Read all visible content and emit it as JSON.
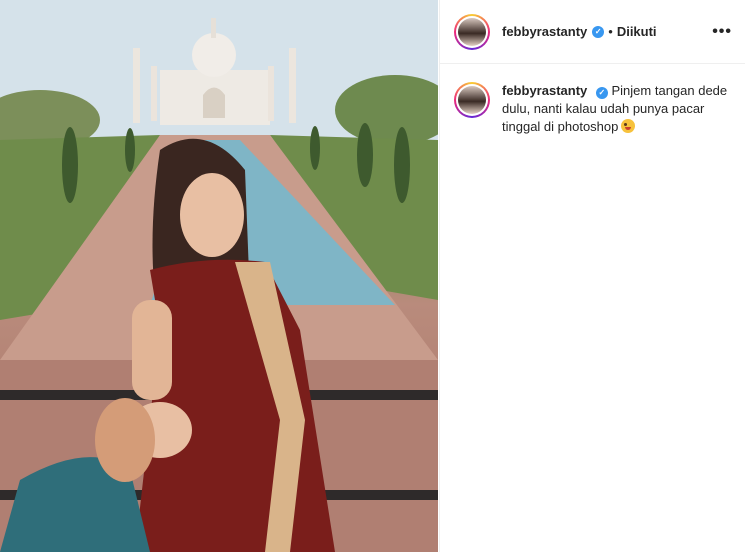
{
  "post": {
    "username": "febbyrastanty",
    "verified": true,
    "separator": "•",
    "follow_status": "Diikuti",
    "more_icon": "more-options-icon",
    "caption_text": "Pinjem tangan dede dulu, nanti kalau udah punya pacar tinggal di photoshop",
    "caption_emoji": "winking-face-with-tongue-emoji"
  },
  "colors": {
    "verified_badge": "#3897f0",
    "border": "#efefef",
    "text": "#262626"
  }
}
